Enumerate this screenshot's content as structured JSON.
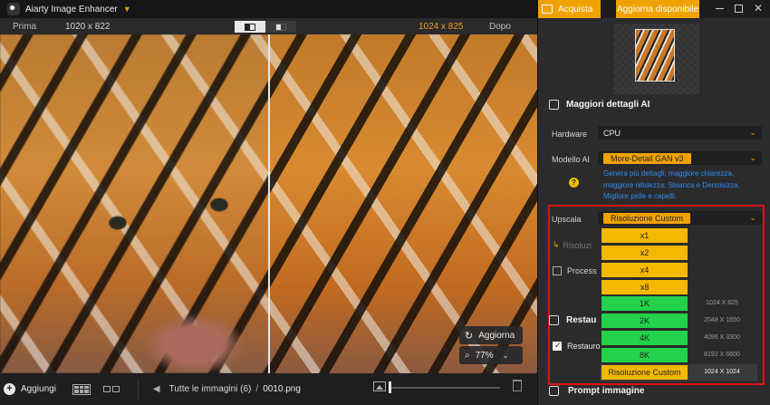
{
  "app": {
    "title": "Aiarty Image Enhancer"
  },
  "compare": {
    "before_label": "Prima",
    "before_res": "1020 x 822",
    "after_res": "1024 x 825",
    "after_label": "Dopo"
  },
  "viewer": {
    "refresh_label": "Aggiorna",
    "zoom_value": "77%"
  },
  "bottom": {
    "add_label": "Aggiungi",
    "all_images": "Tutte le immagini (6)",
    "separator": "/",
    "filename": "0010.png"
  },
  "panel": {
    "buy_label": "Acquista",
    "update_label": "Aggiorna disponibile",
    "details_title": "Maggiori dettagli AI",
    "hardware_label": "Hardware",
    "hardware_value": "CPU",
    "model_label": "Modello AI",
    "model_value": "More-Detail GAN  v3",
    "model_desc": "Genera più dettagli, maggiore chiarezza, maggiore nitidezza. Sbianca e Denoisizza. Migliore pelle e capelli.",
    "upscale_label": "Upscala",
    "upscale_value": "Risoluzione Custom",
    "resolution_label": "Risoluzi",
    "process_label": "Process",
    "restore_title": "Restau",
    "restore_check_label": "Restauro",
    "prompt_title": "Prompt immagine",
    "options": [
      {
        "label": "x1",
        "res": ""
      },
      {
        "label": "x2",
        "res": ""
      },
      {
        "label": "x4",
        "res": ""
      },
      {
        "label": "x8",
        "res": ""
      },
      {
        "label": "1K",
        "res": "1024 X 825"
      },
      {
        "label": "2K",
        "res": "2048 X 1650"
      },
      {
        "label": "4K",
        "res": "4096 X 3300"
      },
      {
        "label": "8K",
        "res": "8192 X 6600"
      },
      {
        "label": "Risoluzione Custom",
        "res": "1024 X 1024"
      }
    ]
  },
  "icons": {
    "app": "app-logo-icon",
    "cart": "cart-icon",
    "refresh": "refresh-icon",
    "zoom": "zoom-icon",
    "help": "help-icon"
  },
  "colors": {
    "accent": "#f0a200",
    "green": "#22d24a",
    "highlight_box": "#e01010",
    "desc_blue": "#2d8cf0"
  }
}
